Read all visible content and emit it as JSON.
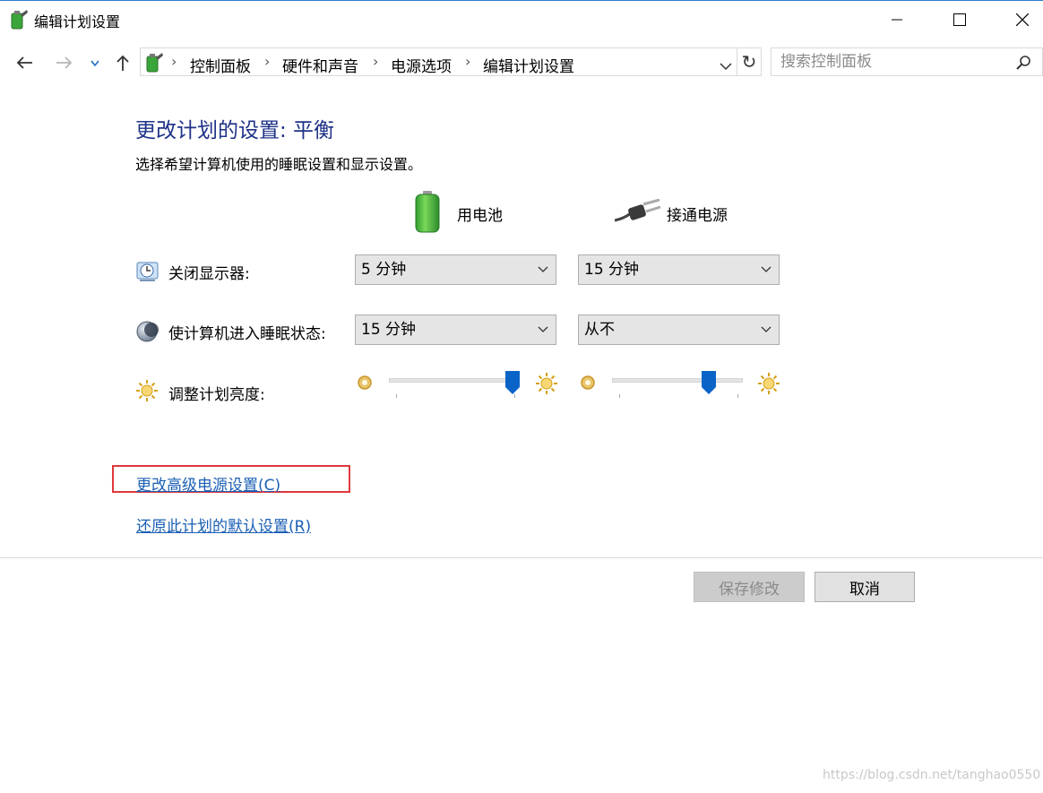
{
  "window": {
    "title": "编辑计划设置",
    "minimize_glyph": "—",
    "maximize_glyph": "☐",
    "close_glyph": "✕"
  },
  "nav": {
    "back_glyph": "←",
    "forward_glyph": "→",
    "recent_glyph": "⌄",
    "up_glyph": "↑",
    "breadcrumbs": [
      "控制面板",
      "硬件和声音",
      "电源选项",
      "编辑计划设置"
    ],
    "separator": "›",
    "refresh_glyph": "↻",
    "search_placeholder": "搜索控制面板"
  },
  "main": {
    "heading": "更改计划的设置: 平衡",
    "description": "选择希望计算机使用的睡眠设置和显示设置。",
    "columns": {
      "battery": "用电池",
      "plugged_in": "接通电源"
    },
    "rows": {
      "display_off": {
        "label": "关闭显示器:",
        "battery_value": "5 分钟",
        "plugged_value": "15 分钟"
      },
      "sleep": {
        "label": "使计算机进入睡眠状态:",
        "battery_value": "15 分钟",
        "plugged_value": "从不"
      },
      "brightness": {
        "label": "调整计划亮度:",
        "battery_level": 1.0,
        "plugged_level": 0.77
      }
    },
    "links": {
      "advanced": "更改高级电源设置(C)",
      "restore": "还原此计划的默认设置(R)"
    }
  },
  "footer": {
    "save_label": "保存修改",
    "cancel_label": "取消"
  },
  "watermark": "https://blog.csdn.net/tanghao0550",
  "colors": {
    "heading": "#1e3287",
    "link": "#1a5fb4",
    "highlight": "#e0393d",
    "slider_thumb": "#0a64c8"
  }
}
